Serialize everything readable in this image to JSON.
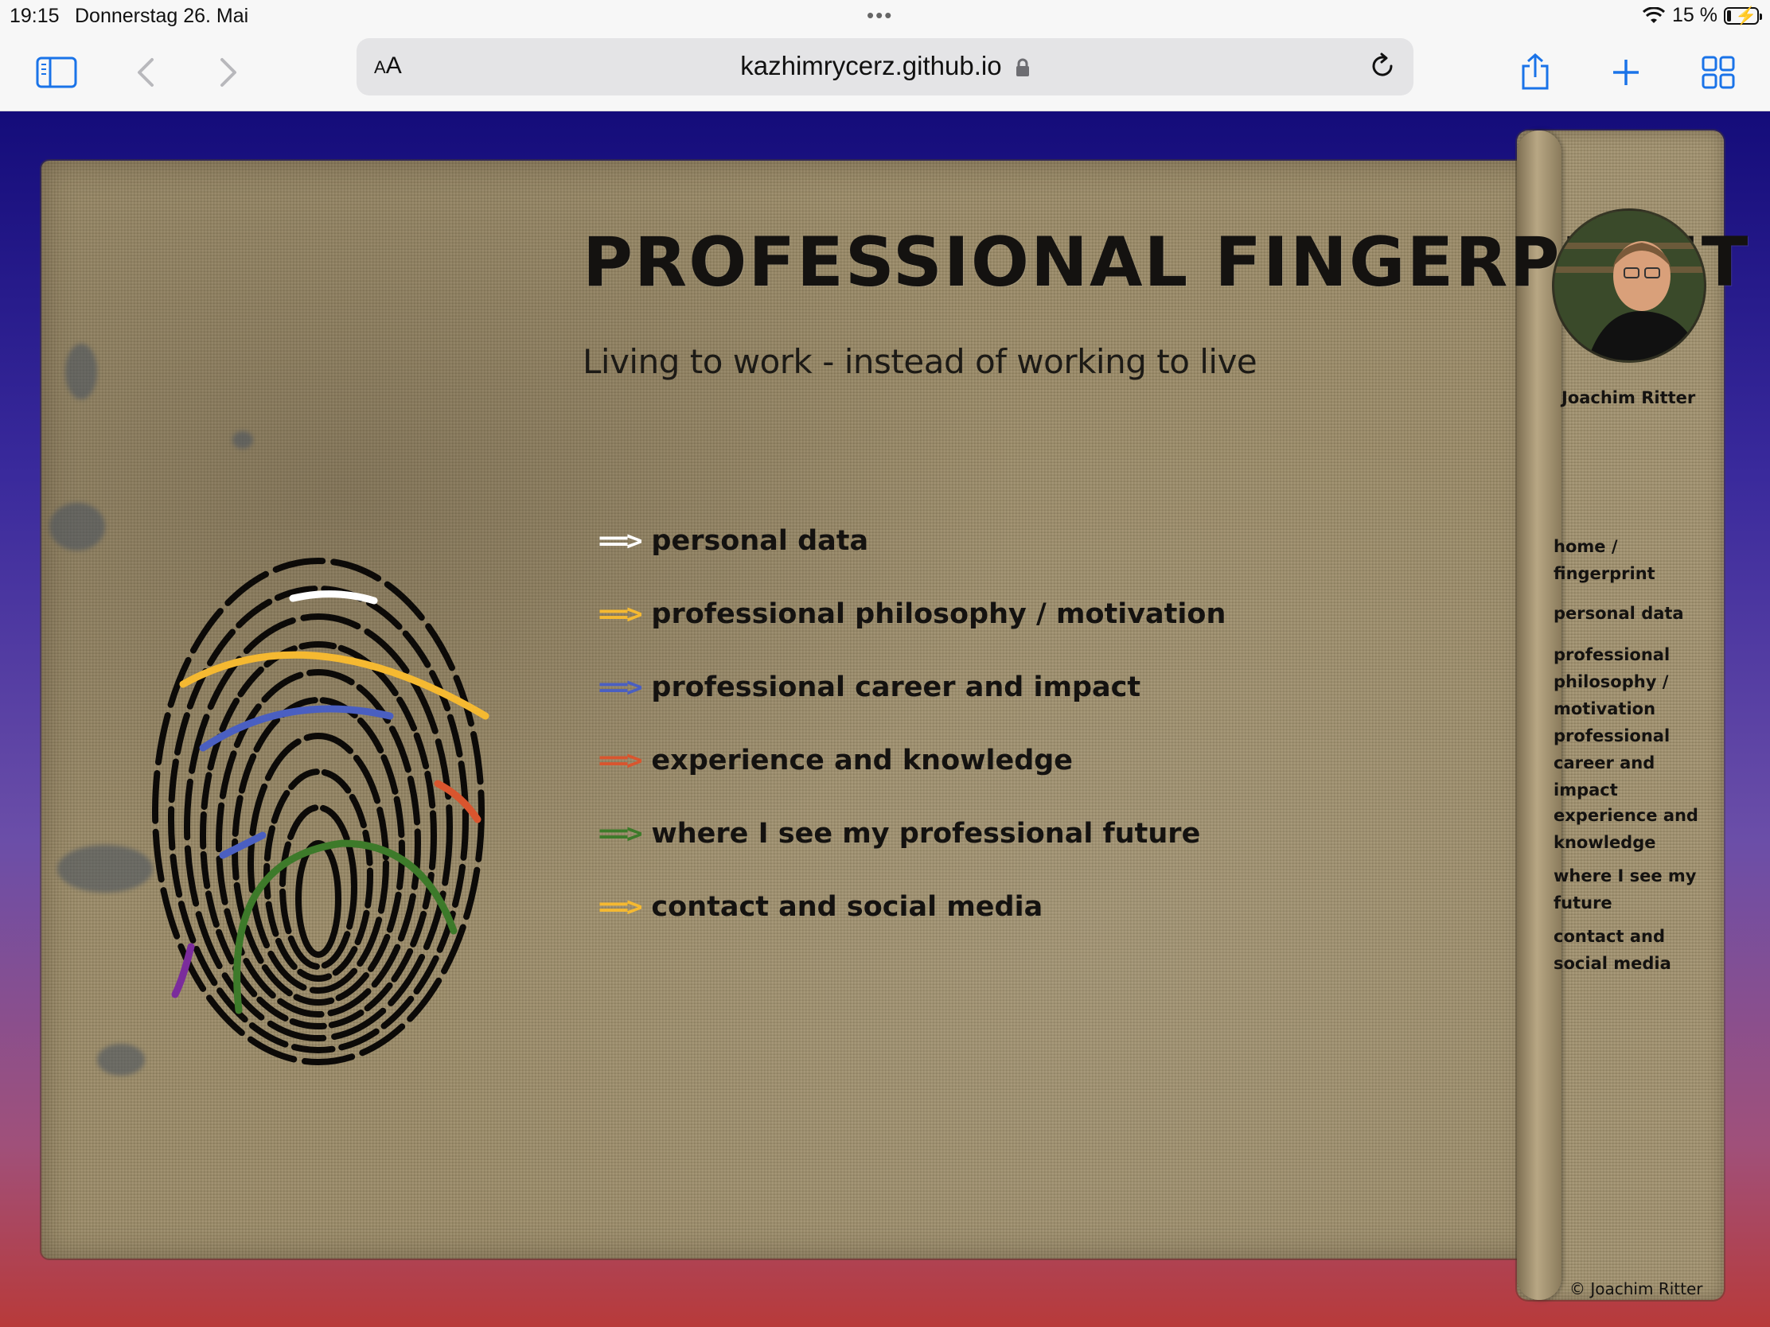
{
  "status_bar": {
    "time": "19:15",
    "date": "Donnerstag 26. Mai",
    "battery_percent": "15 %",
    "battery_level": 0.15
  },
  "browser": {
    "url": "kazhimrycerz.github.io",
    "text_size_button": "AA",
    "icons": [
      "sidebar-icon",
      "back-icon",
      "forward-icon",
      "lock-icon",
      "reload-icon",
      "share-icon",
      "new-tab-icon",
      "tabs-overview-icon"
    ]
  },
  "page": {
    "title": "PROFESSIONAL FINGERPRINT",
    "subtitle": "Living to work - instead of working to live",
    "menu": [
      {
        "arrow": "==>",
        "label": "personal data",
        "color": "#ffffff"
      },
      {
        "arrow": "==>",
        "label": "professional philosophy / motivation",
        "color": "#f5b931"
      },
      {
        "arrow": "==>",
        "label": "professional career and impact",
        "color": "#4a5fc1"
      },
      {
        "arrow": "==>",
        "label": "experience and knowledge",
        "color": "#d9552e"
      },
      {
        "arrow": "==>",
        "label": "where I see my professional future",
        "color": "#3d7a2a"
      },
      {
        "arrow": "==>",
        "label": "contact and social media",
        "color": "#f5b931"
      }
    ],
    "author": "Joachim Ritter",
    "sidenav": [
      "home / fingerprint",
      "personal data",
      "professional philosophy / motivation",
      "professional career and impact",
      "experience and knowledge",
      "where I see my future",
      "contact and social media"
    ],
    "copyright": "© Joachim Ritter",
    "colors": {
      "background_top": "#140c7a",
      "background_bottom": "#b83a3a",
      "linen": "#9a8a66"
    }
  }
}
